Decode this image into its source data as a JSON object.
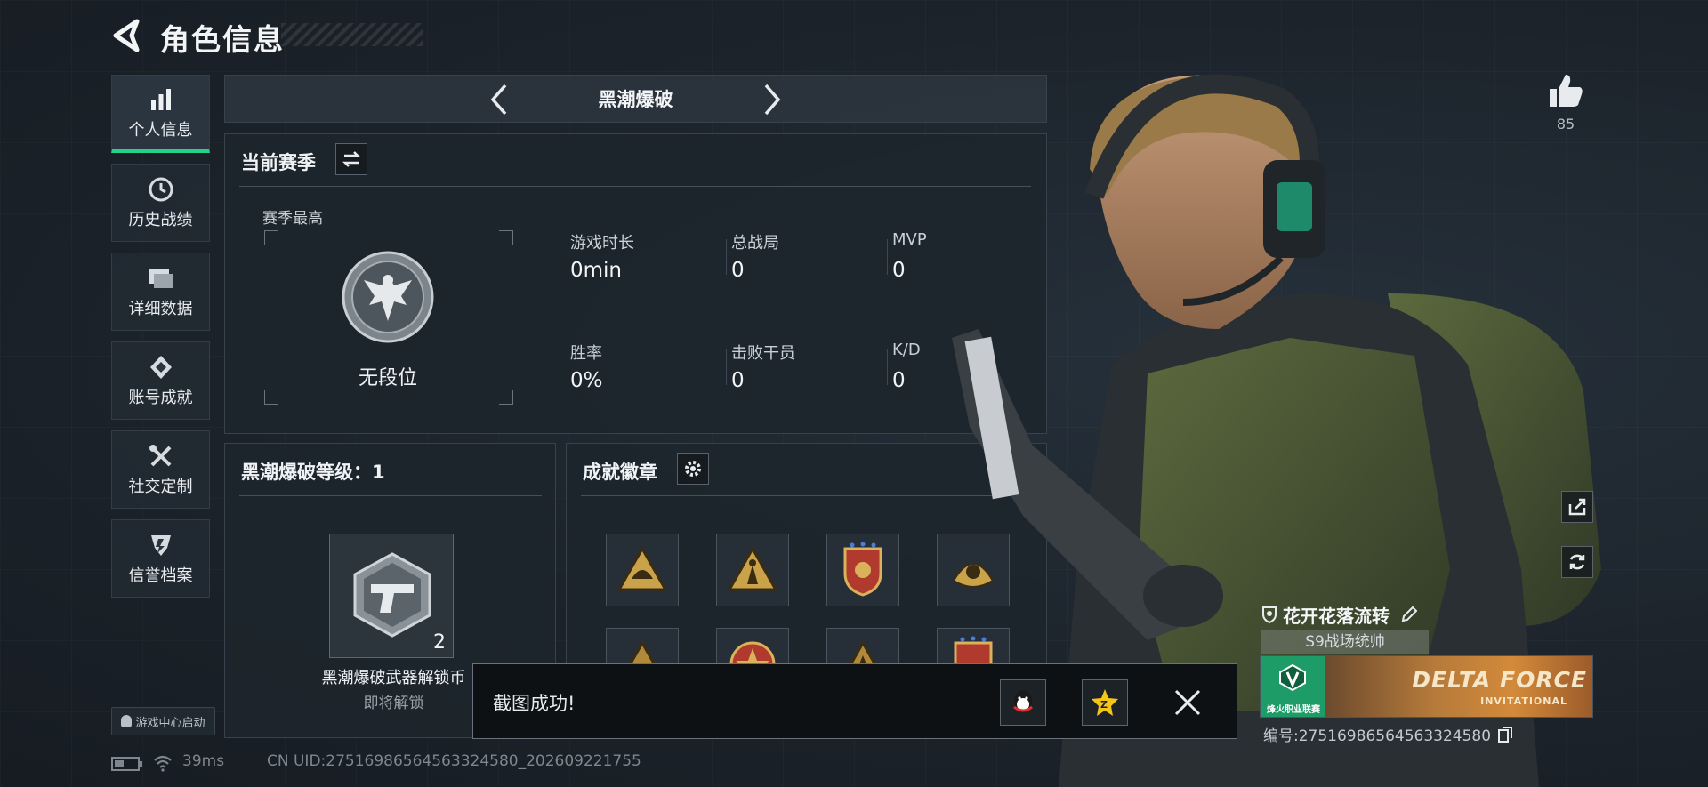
{
  "header": {
    "title": "角色信息"
  },
  "sidebar": {
    "items": [
      {
        "label": "个人信息",
        "icon": "bar-chart-icon",
        "active": true
      },
      {
        "label": "历史战绩",
        "icon": "clock-icon"
      },
      {
        "label": "详细数据",
        "icon": "folder-icon"
      },
      {
        "label": "账号成就",
        "icon": "medal-icon"
      },
      {
        "label": "社交定制",
        "icon": "tools-icon"
      },
      {
        "label": "信誉档案",
        "icon": "shield-icon"
      }
    ],
    "game_center": "游戏中心启动"
  },
  "mode": {
    "name": "黑潮爆破"
  },
  "season": {
    "title": "当前赛季",
    "highest_label": "赛季最高",
    "rank_name": "无段位",
    "stats": [
      {
        "label": "游戏时长",
        "value": "0min"
      },
      {
        "label": "总战局",
        "value": "0"
      },
      {
        "label": "MVP",
        "value": "0"
      },
      {
        "label": "胜率",
        "value": "0%"
      },
      {
        "label": "击败干员",
        "value": "0"
      },
      {
        "label": "K/D",
        "value": "0"
      }
    ]
  },
  "level": {
    "title": "黑潮爆破等级：1",
    "weapon_count": "2",
    "weapon_name": "黑潮爆破武器解锁币",
    "weapon_status": "即将解锁"
  },
  "achievements": {
    "title": "成就徽章",
    "badges": [
      "badge-triangle-helmet",
      "badge-triangle-soldier",
      "badge-shield-star",
      "badge-wreath-gold",
      "badge-triangle-2",
      "badge-star-round",
      "badge-triangle-3",
      "badge-shield-2"
    ]
  },
  "toast": {
    "text": "截图成功!"
  },
  "status": {
    "ping": "39ms",
    "uid": "CN UID:27516986564563324580_202609221755"
  },
  "profile": {
    "likes": "85",
    "player_name": "花开花落流转",
    "rank_title": "S9战场统帅",
    "banner_left_text": "烽火职业联赛",
    "banner_logo": "DELTA FORCE",
    "banner_logo_sub": "INVITATIONAL",
    "id_line": "编号:27516986564563324580"
  },
  "colors": {
    "accent": "#25d08a",
    "gold": "#c9a24a",
    "panel": "#1e252c"
  }
}
